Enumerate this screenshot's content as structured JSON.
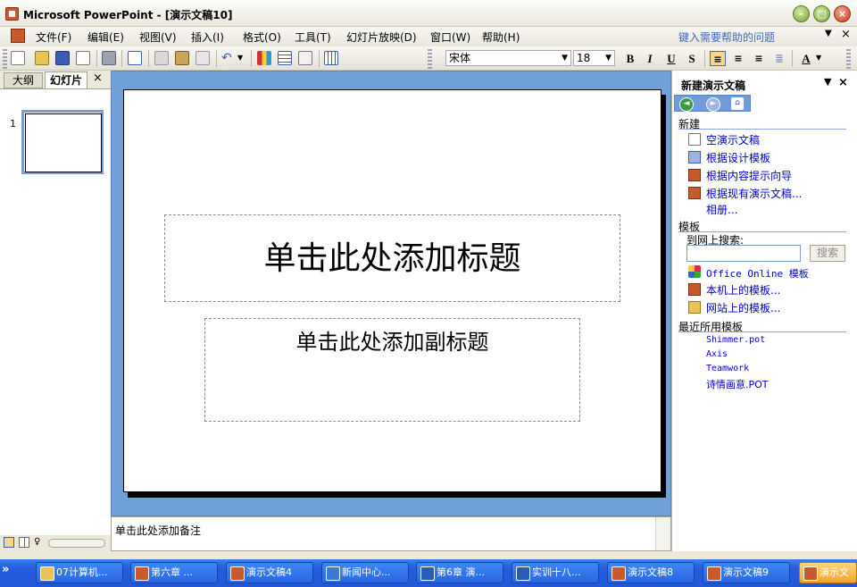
{
  "window": {
    "title": "Microsoft PowerPoint - [演示文稿10]"
  },
  "menubar": {
    "items": [
      "文件(F)",
      "编辑(E)",
      "视图(V)",
      "插入(I)",
      "格式(O)",
      "工具(T)",
      "幻灯片放映(D)",
      "窗口(W)",
      "帮助(H)"
    ],
    "help_placeholder": "键入需要帮助的问题",
    "close": "×"
  },
  "toolbar": {
    "font_name": "宋体",
    "font_size": "18",
    "bold": "B",
    "italic": "I",
    "underline": "U",
    "shadow": "S",
    "font_color": "A"
  },
  "left_panel": {
    "tab_outline": "大纲",
    "tab_slides": "幻灯片",
    "close": "×",
    "slide_number": "1"
  },
  "slide": {
    "title_placeholder": "单击此处添加标题",
    "subtitle_placeholder": "单击此处添加副标题"
  },
  "notes": {
    "placeholder": "单击此处添加备注"
  },
  "taskpane": {
    "title": "新建演示文稿",
    "section_new": "新建",
    "new_links": [
      "空演示文稿",
      "根据设计模板",
      "根据内容提示向导",
      "根据现有演示文稿...",
      "相册..."
    ],
    "section_templates": "模板",
    "search_label": "到网上搜索:",
    "search_button": "搜索",
    "template_links": [
      "Office Online 模板",
      "本机上的模板...",
      "网站上的模板..."
    ],
    "section_recent": "最近所用模板",
    "recent_templates": [
      "Shimmer.pot",
      "Axis",
      "Teamwork",
      "诗情画意.POT"
    ]
  },
  "taskbar": {
    "tasks": [
      "07计算机...",
      "第六章 ...",
      "演示文稿4",
      "新闻中心...",
      "第6章 演...",
      "实训十八...",
      "演示文稿8",
      "演示文稿9",
      "演示文"
    ]
  },
  "colors": {
    "workspace": "#6FA0D8",
    "taskbar": "#245EDC",
    "link": "#0000CC"
  }
}
